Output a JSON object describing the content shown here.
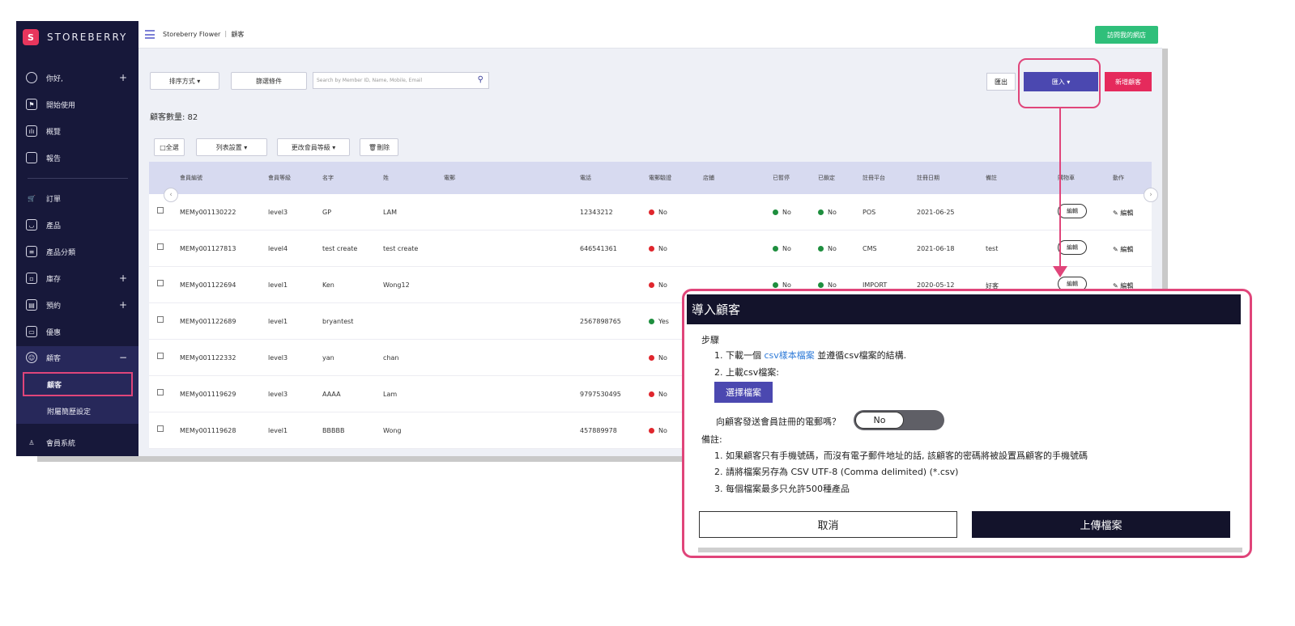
{
  "brand": {
    "logo_glyph": "S",
    "name": "STOREBERRY"
  },
  "sidebar": {
    "items": [
      {
        "icon": "user-icon",
        "label": "你好,",
        "plus": "+"
      },
      {
        "icon": "flag-icon",
        "label": "開始使用"
      },
      {
        "icon": "chart-icon",
        "label": "概覽"
      },
      {
        "icon": "file-icon",
        "label": "報告"
      },
      {
        "icon": "cart-icon",
        "label": "訂單"
      },
      {
        "icon": "product-icon",
        "label": "產品"
      },
      {
        "icon": "list-icon",
        "label": "產品分類"
      },
      {
        "icon": "inventory-icon",
        "label": "庫存",
        "plus": "+"
      },
      {
        "icon": "calendar-icon",
        "label": "預約",
        "plus": "+"
      },
      {
        "icon": "coupon-icon",
        "label": "優惠"
      },
      {
        "icon": "customer-icon",
        "label": "顧客",
        "plus": "−"
      },
      {
        "icon": "member-icon",
        "label": "會員系統"
      }
    ],
    "sub_items": [
      "顧客",
      "附屬簡歷設定"
    ]
  },
  "topbar": {
    "breadcrumb": "Storeberry Flower ｜ 顧客",
    "visit_store": "訪問我的網店"
  },
  "toolbar": {
    "sort": "排序方式 ▾",
    "filter": "篩選條件",
    "search_placeholder": "Search by Member ID, Name, Mobile, Email",
    "export": "匯出",
    "import": "匯入 ▾",
    "new_customer": "新增顧客",
    "count": "顧客數量: 82",
    "select_all": "□全選",
    "list_settings": "列表設置 ▾",
    "change_level": "更改會員等級 ▾",
    "delete": "🗑刪除"
  },
  "table": {
    "headers": [
      "會員編號",
      "會員等級",
      "名字",
      "姓",
      "電郵",
      "電話",
      "電郵驗證",
      "店鋪",
      "已暫停",
      "已鎖定",
      "註冊平台",
      "註冊日期",
      "備註",
      "購物車",
      "動作"
    ],
    "rows": [
      {
        "id": "MEMy001130222",
        "level": "level3",
        "first": "GP",
        "last": "LAM",
        "phone": "12343212",
        "email_verified": "No",
        "suspended": "No",
        "locked": "No",
        "platform": "POS",
        "date": "2021-06-25",
        "note": ""
      },
      {
        "id": "MEMy001127813",
        "level": "level4",
        "first": "test create",
        "last": "test create",
        "phone": "646541361",
        "email_verified": "No",
        "suspended": "No",
        "locked": "No",
        "platform": "CMS",
        "date": "2021-06-18",
        "note": "test"
      },
      {
        "id": "MEMy001122694",
        "level": "level1",
        "first": "Ken",
        "last": "Wong12",
        "phone": "",
        "email_verified": "No",
        "suspended": "No",
        "locked": "No",
        "platform": "IMPORT",
        "date": "2020-05-12",
        "note": "好客"
      },
      {
        "id": "MEMy001122689",
        "level": "level1",
        "first": "bryantest",
        "last": "",
        "phone": "2567898765",
        "email_verified": "Yes"
      },
      {
        "id": "MEMy001122332",
        "level": "level3",
        "first": "yan",
        "last": "chan",
        "phone": "",
        "email_verified": "No"
      },
      {
        "id": "MEMy001119629",
        "level": "level3",
        "first": "AAAA",
        "last": "Lam",
        "phone": "9797530495",
        "email_verified": "No"
      },
      {
        "id": "MEMy001119628",
        "level": "level1",
        "first": "BBBBB",
        "last": "Wong",
        "phone": "457889978",
        "email_verified": "No"
      }
    ],
    "edit_pill": "編輯",
    "edit_action": "✎ 編輯"
  },
  "modal": {
    "title": "導入顧客",
    "steps_label": "步驟",
    "step1_prefix": "1. 下載一個",
    "step1_link": "csv樣本檔案",
    "step1_suffix": "並遵循csv檔案的結構.",
    "step2": "2. 上載csv檔案:",
    "choose_file": "選擇檔案",
    "email_question": "向顧客發送會員註冊的電郵嗎？",
    "toggle_value": "No",
    "notes_label": "備註:",
    "note1": "1. 如果顧客只有手機號碼，而沒有電子郵件地址的話, 該顧客的密碼將被設置爲顧客的手機號碼",
    "note2": "2. 請將檔案另存為 CSV UTF-8 (Comma delimited) (*.csv)",
    "note3": "3. 每個檔案最多只允許500種產品",
    "cancel": "取消",
    "upload": "上傳檔案"
  },
  "colors": {
    "accent": "#e0457a",
    "primary": "#4b48b0",
    "sidebar": "#17183a",
    "danger": "#e52a5c",
    "success": "#2fbf7a"
  }
}
